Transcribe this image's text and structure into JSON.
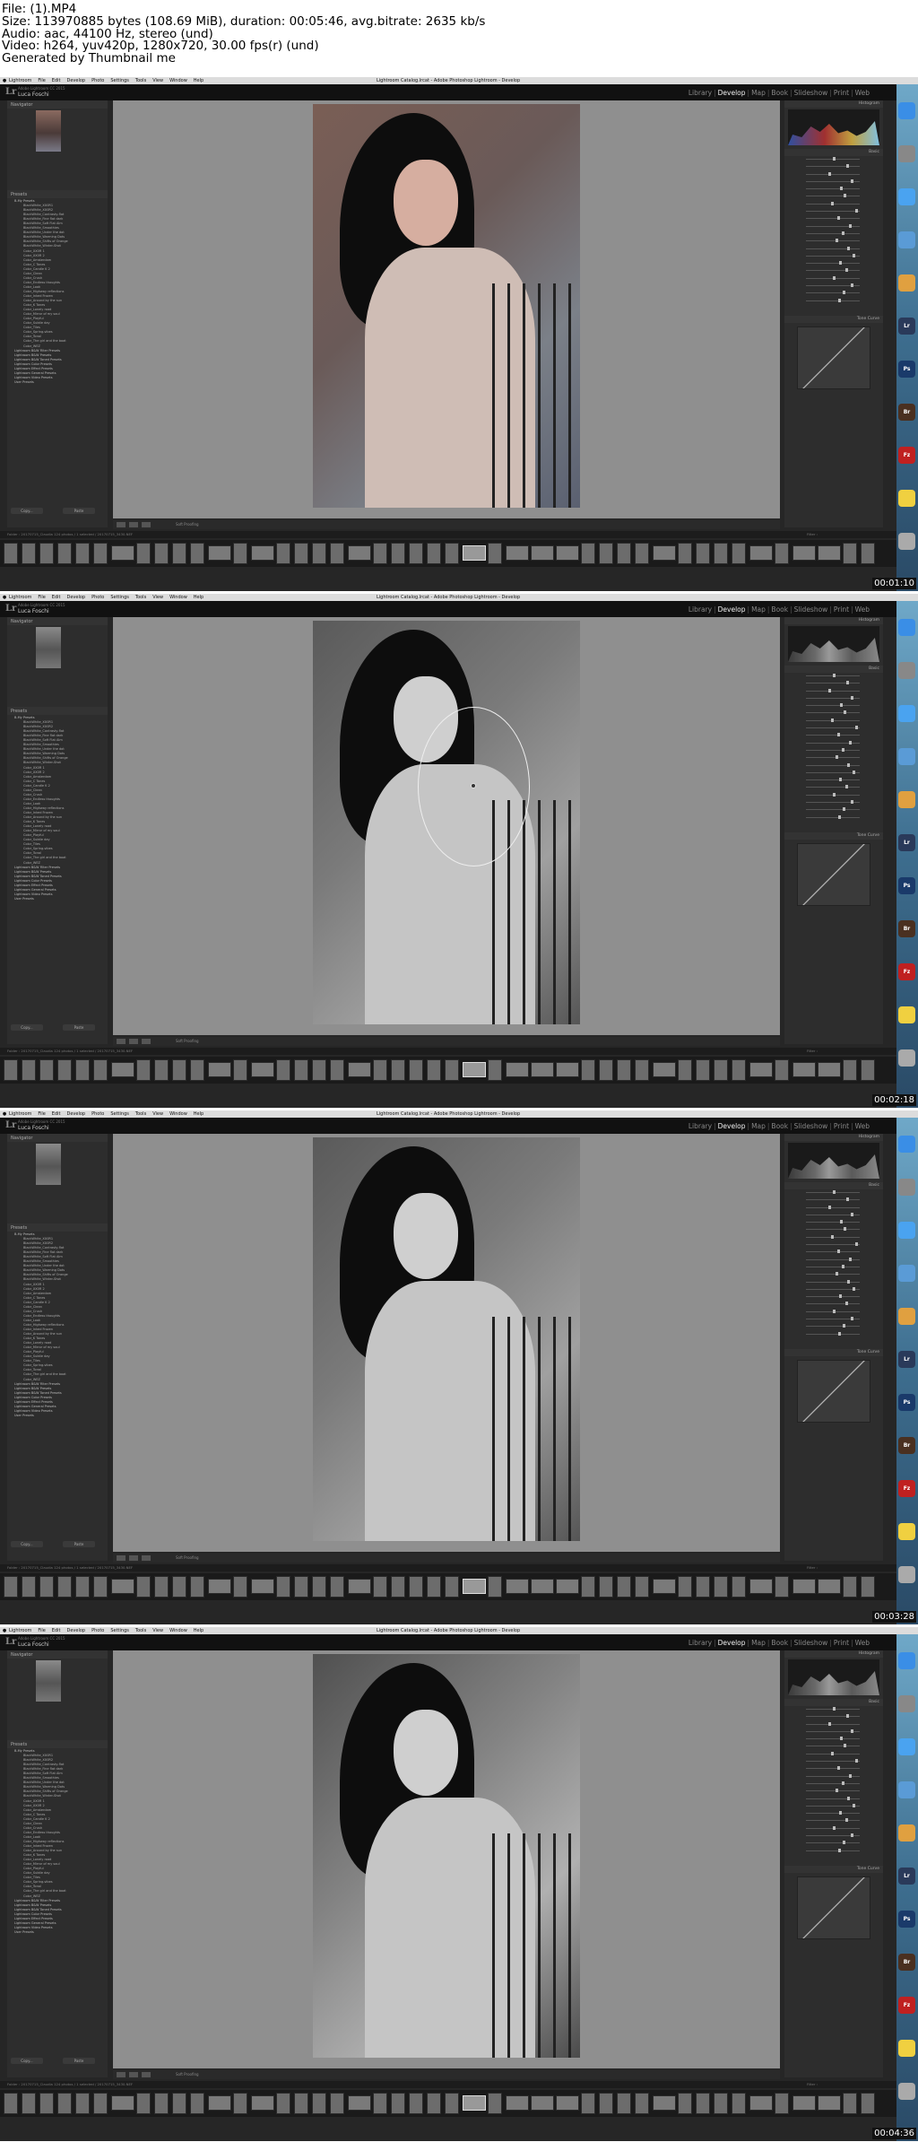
{
  "header": {
    "lines": [
      "File: (1).MP4",
      "Size: 113970885 bytes (108.69 MiB), duration: 00:05:46, avg.bitrate: 2635 kb/s",
      "Audio: aac, 44100 Hz, stereo (und)",
      "Video: h264, yuv420p, 1280x720, 30.00 fps(r) (und)",
      "Generated by Thumbnail me"
    ]
  },
  "menubar": {
    "items": [
      "Lightroom",
      "File",
      "Edit",
      "Develop",
      "Photo",
      "Settings",
      "Tools",
      "View",
      "Window",
      "Help"
    ],
    "title": "Lightroom Catalog.lrcat - Adobe Photoshop Lightroom - Develop"
  },
  "identity": {
    "small": "Adobe Lightroom CC 2015",
    "name": "Luca Foschi"
  },
  "modules": [
    "Library",
    "Develop",
    "Map",
    "Book",
    "Slideshow",
    "Print",
    "Web"
  ],
  "active_module": "Develop",
  "left_panel": {
    "navigator": "Navigator",
    "presets": "Presets",
    "preset_items": [
      "B-My Presets",
      "BlackWhite_XX0R1",
      "BlackWhite_XX0R2",
      "BlackWhite_Contrasty-flat",
      "BlackWhite_Fine flat dark",
      "BlackWhite_Soft Flat Alm",
      "BlackWhite_Smoothies",
      "BlackWhite_Under the dot",
      "BlackWhite_Warming Dots",
      "BlackWhite_Shifts of Orange",
      "BlackWhite_Winter-Shot",
      "Color_XX0R 1",
      "Color_XX0R 2",
      "Color_Amsterdam",
      "Color_C Tones",
      "Color_Candle K 2",
      "Color_Clean",
      "Color_Crush",
      "Color_Endless thoughts",
      "Color_Look",
      "Color_Highway reflections",
      "Color_Inked Frozen",
      "Color_Around by the sun",
      "Color_K Tones",
      "Color_Lonely road",
      "Color_Mirror of my soul",
      "Color_Playful",
      "Color_Subtle day",
      "Color_Tiles",
      "Color_Spring-vibes",
      "Color_Tonal",
      "Color_The girl and the boat",
      "Color_WEZ",
      "Lightroom B&W Filter Presets",
      "Lightroom B&W Presets",
      "Lightroom B&W Toned Presets",
      "Lightroom Color Presets",
      "Lightroom Effect Presets",
      "Lightroom General Presets",
      "Lightroom Video Presets",
      "User Presets"
    ],
    "copy": "Copy...",
    "paste": "Paste"
  },
  "toolbar": {
    "soft_proofing": "Soft Proofing"
  },
  "right_panel": {
    "histogram": "Histogram",
    "basic": "Basic",
    "tone_curve": "Tone Curve",
    "previous": "Previous",
    "reset": "Reset"
  },
  "filmstrip_info": "Folder : 20170715_Claudia   124 photos / 1 selected / 20170715_3430.NEF",
  "filter": "Filter :",
  "frames": [
    {
      "timestamp": "00:01:10",
      "style": "color"
    },
    {
      "timestamp": "00:02:18",
      "style": "bw"
    },
    {
      "timestamp": "00:03:28",
      "style": "bw"
    },
    {
      "timestamp": "00:04:36",
      "style": "bw2"
    }
  ],
  "dock_icons": [
    "finder-icon",
    "launchpad-icon",
    "safari-icon",
    "mail-icon",
    "photos-icon",
    "lightroom-icon",
    "photoshop-icon",
    "bridge-icon",
    "filezilla-icon",
    "notes-icon",
    "trash-icon"
  ]
}
